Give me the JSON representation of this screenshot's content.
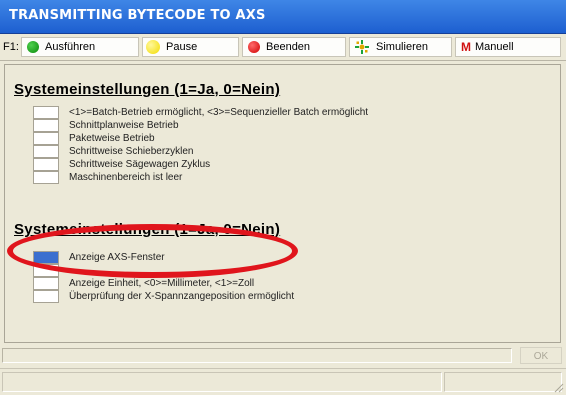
{
  "window": {
    "title": "TRANSMITTING BYTECODE TO AXS"
  },
  "toolbar": {
    "prefix": "F1:",
    "buttons": [
      {
        "label": "Ausführen",
        "icon": "green-circle-icon"
      },
      {
        "label": "Pause",
        "icon": "yellow-circle-icon"
      },
      {
        "label": "Beenden",
        "icon": "red-circle-icon"
      },
      {
        "label": "Simulieren",
        "icon": "simulate-icon"
      },
      {
        "label": "Manuell",
        "icon": "m-icon",
        "icon_text": "M"
      }
    ]
  },
  "section1": {
    "heading": "Systemeinstellungen (1=Ja, 0=Nein)",
    "items": [
      {
        "label": "<1>=Batch-Betrieb ermöglicht, <3>=Sequenzieller Batch ermöglicht",
        "checked": false
      },
      {
        "label": "Schnittplanweise Betrieb",
        "checked": false
      },
      {
        "label": "Paketweise Betrieb",
        "checked": false
      },
      {
        "label": "Schrittweise Schieberzyklen",
        "checked": false
      },
      {
        "label": "Schrittweise Sägewagen Zyklus",
        "checked": false
      },
      {
        "label": "Maschinenbereich ist leer",
        "checked": false
      }
    ]
  },
  "section2": {
    "heading": "Systemeinstellungen (1=Ja, 0=Nein)",
    "items": [
      {
        "label": "Anzeige AXS-Fenster",
        "checked": true
      },
      {
        "label": "",
        "checked": false
      },
      {
        "label": "Anzeige Einheit, <0>=Millimeter, <1>=Zoll",
        "checked": false
      },
      {
        "label": "Überprüfung der X-Spannzangeposition ermöglicht",
        "checked": false
      }
    ]
  },
  "statusbar": {
    "ok_label": "OK"
  },
  "colors": {
    "titlebar": "#1d5fd0",
    "highlight_ellipse": "#e0151c",
    "checked": "#3b6fcf"
  }
}
